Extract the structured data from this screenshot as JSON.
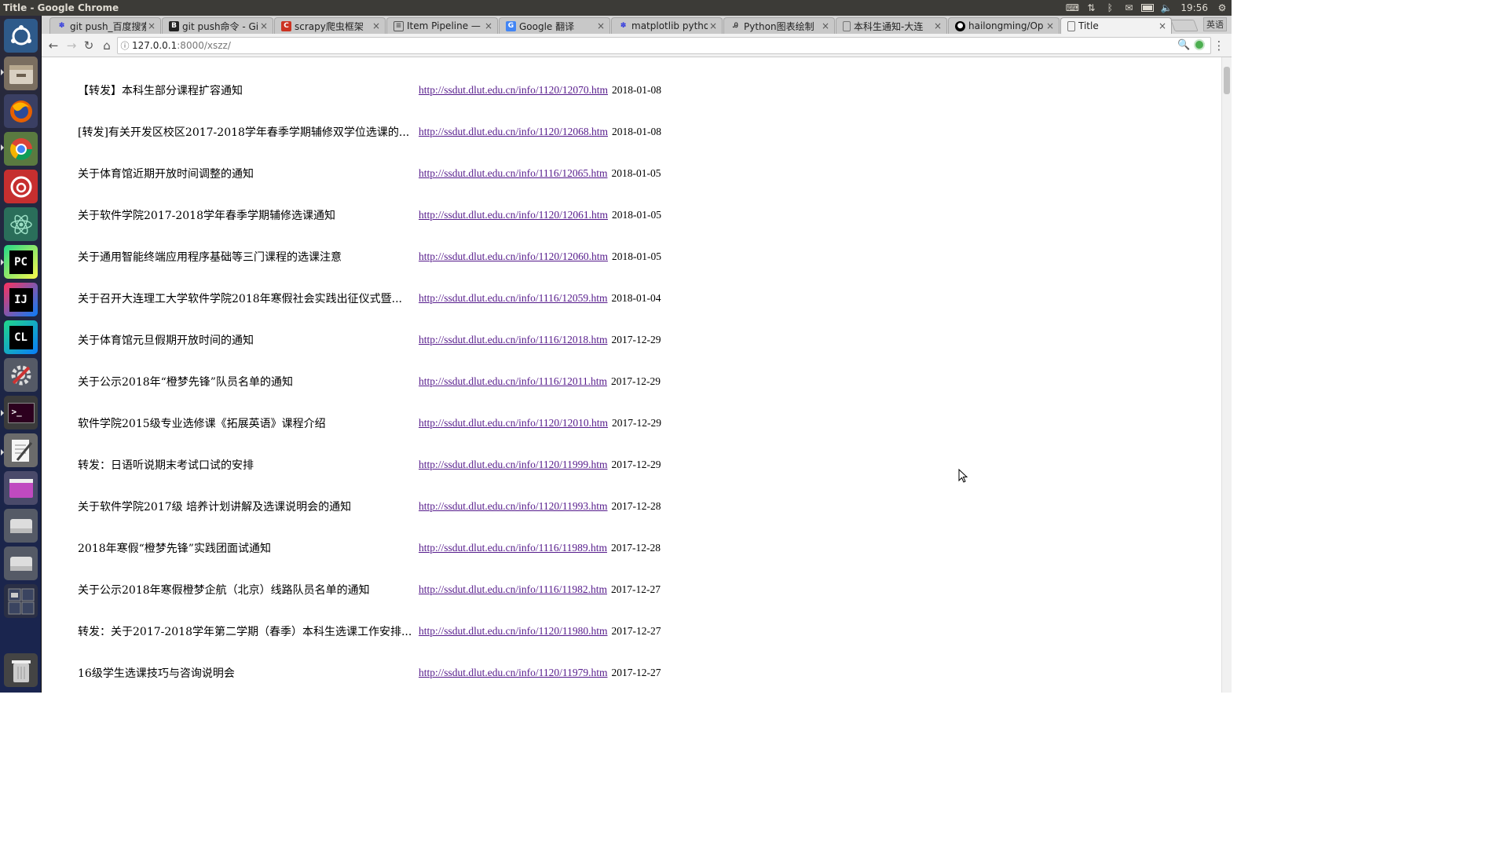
{
  "window": {
    "title": "Title - Google Chrome",
    "clock": "19:56"
  },
  "launcher": {
    "apps": [
      "ubuntu-dash",
      "files",
      "firefox",
      "chrome",
      "netease-music",
      "atom",
      "pycharm",
      "intellij",
      "clion",
      "system-settings",
      "terminal",
      "text-editor",
      "gimp",
      "disk-1",
      "disk-2",
      "workspace-switcher",
      "trash"
    ]
  },
  "tabs": [
    {
      "label": "git push_百度搜索",
      "favicon": "baidu"
    },
    {
      "label": "git push命令 - Git",
      "favicon": "bootstrap"
    },
    {
      "label": "scrapy爬虫框架",
      "favicon": "csdn"
    },
    {
      "label": "Item Pipeline — S",
      "favicon": "doc"
    },
    {
      "label": "Google 翻译",
      "favicon": "translate"
    },
    {
      "label": "matplotlib pytho",
      "favicon": "baidu"
    },
    {
      "label": "Python图表绘制",
      "favicon": "jianshu"
    },
    {
      "label": "本科生通知-大连",
      "favicon": "page"
    },
    {
      "label": "hailongming/Op",
      "favicon": "github"
    },
    {
      "label": "Title",
      "favicon": "page",
      "active": true
    }
  ],
  "tabstrip": {
    "lang_button": "英语"
  },
  "toolbar": {
    "url_host": "127.0.0.1",
    "url_path": ":8000/xszz/"
  },
  "notices": [
    {
      "title": "【转发】本科生部分课程扩容通知",
      "link": "http://ssdut.dlut.edu.cn/info/1120/12070.htm",
      "date": "2018-01-08"
    },
    {
      "title": "[转发]有关开发区校区2017-2018学年春季学期辅修双学位选课的...",
      "link": "http://ssdut.dlut.edu.cn/info/1120/12068.htm",
      "date": "2018-01-08"
    },
    {
      "title": "关于体育馆近期开放时间调整的通知",
      "link": "http://ssdut.dlut.edu.cn/info/1116/12065.htm",
      "date": "2018-01-05"
    },
    {
      "title": "关于软件学院2017-2018学年春季学期辅修选课通知",
      "link": "http://ssdut.dlut.edu.cn/info/1120/12061.htm",
      "date": "2018-01-05"
    },
    {
      "title": "关于通用智能终端应用程序基础等三门课程的选课注意",
      "link": "http://ssdut.dlut.edu.cn/info/1120/12060.htm",
      "date": "2018-01-05"
    },
    {
      "title": "关于召开大连理工大学软件学院2018年寒假社会实践出征仪式暨...",
      "link": "http://ssdut.dlut.edu.cn/info/1116/12059.htm",
      "date": "2018-01-04"
    },
    {
      "title": "关于体育馆元旦假期开放时间的通知",
      "link": "http://ssdut.dlut.edu.cn/info/1116/12018.htm",
      "date": "2017-12-29"
    },
    {
      "title": "关于公示2018年“橙梦先锋”队员名单的通知",
      "link": "http://ssdut.dlut.edu.cn/info/1116/12011.htm",
      "date": "2017-12-29"
    },
    {
      "title": "软件学院2015级专业选修课《拓展英语》课程介绍",
      "link": "http://ssdut.dlut.edu.cn/info/1120/12010.htm",
      "date": "2017-12-29"
    },
    {
      "title": "转发：日语听说期末考试口试的安排",
      "link": "http://ssdut.dlut.edu.cn/info/1120/11999.htm",
      "date": "2017-12-29"
    },
    {
      "title": "关于软件学院2017级 培养计划讲解及选课说明会的通知",
      "link": "http://ssdut.dlut.edu.cn/info/1120/11993.htm",
      "date": "2017-12-28"
    },
    {
      "title": "2018年寒假“橙梦先锋”实践团面试通知",
      "link": "http://ssdut.dlut.edu.cn/info/1116/11989.htm",
      "date": "2017-12-28"
    },
    {
      "title": "关于公示2018年寒假橙梦企航（北京）线路队员名单的通知",
      "link": "http://ssdut.dlut.edu.cn/info/1116/11982.htm",
      "date": "2017-12-27"
    },
    {
      "title": "转发：关于2017-2018学年第二学期（春季）本科生选课工作安排...",
      "link": "http://ssdut.dlut.edu.cn/info/1120/11980.htm",
      "date": "2017-12-27"
    },
    {
      "title": "16级学生选课技巧与咨询说明会",
      "link": "http://ssdut.dlut.edu.cn/info/1120/11979.htm",
      "date": "2017-12-27"
    }
  ]
}
